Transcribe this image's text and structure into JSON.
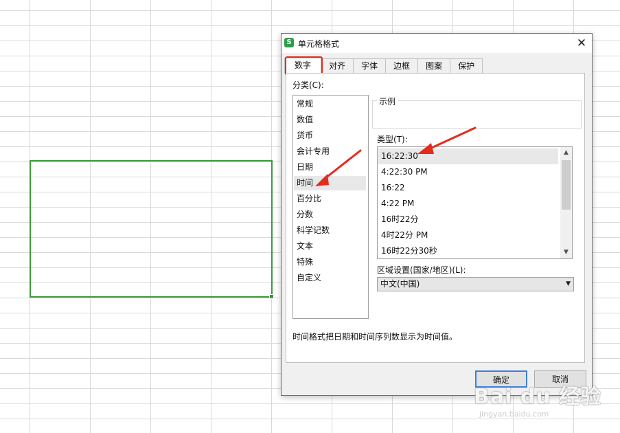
{
  "dialog": {
    "title": "单元格格式",
    "app_icon": "S",
    "close_label": "✕",
    "tabs": [
      {
        "label": "数字",
        "active": true
      },
      {
        "label": "对齐"
      },
      {
        "label": "字体"
      },
      {
        "label": "边框"
      },
      {
        "label": "图案"
      },
      {
        "label": "保护"
      }
    ],
    "category_label": "分类(C):",
    "categories": [
      "常规",
      "数值",
      "货币",
      "会计专用",
      "日期",
      "时间",
      "百分比",
      "分数",
      "科学记数",
      "文本",
      "特殊",
      "自定义"
    ],
    "selected_category": "时间",
    "sample_label": "示例",
    "type_label": "类型(T):",
    "types": [
      "16:22:30",
      "4:22:30 PM",
      "16:22",
      "4:22 PM",
      "16时22分",
      "4时22分 PM",
      "16时22分30秒"
    ],
    "selected_type": "16:22:30",
    "locale_label": "区域设置(国家/地区)(L):",
    "locale_value": "中文(中国)",
    "description": "时间格式把日期和时间序列数显示为时间值。",
    "ok_label": "确定",
    "cancel_label": "取消"
  },
  "watermark": {
    "logo": "Bai du 经验",
    "url": "jingyan.baidu.com"
  },
  "colors": {
    "selection_border": "#3c9a3c",
    "highlight_red": "#e52b1c",
    "ok_border": "#3c7fd8"
  }
}
